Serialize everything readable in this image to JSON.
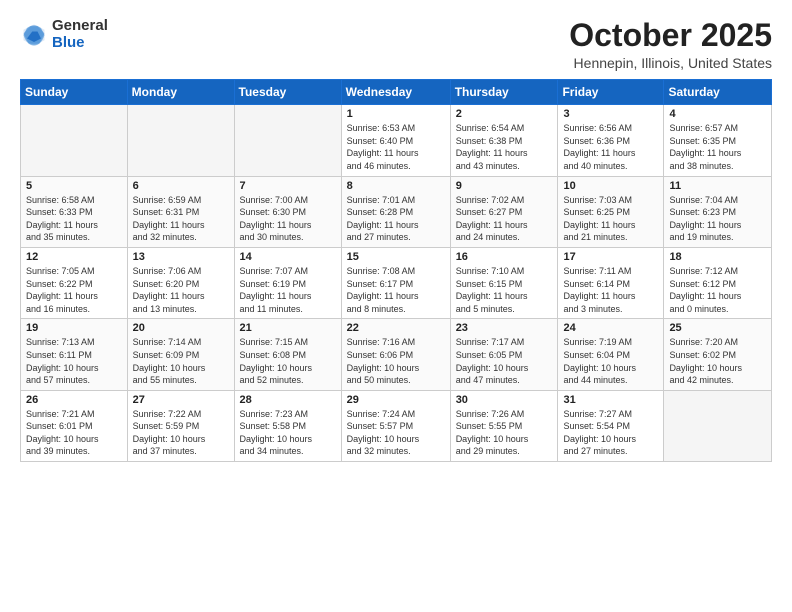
{
  "logo": {
    "general": "General",
    "blue": "Blue"
  },
  "title": "October 2025",
  "location": "Hennepin, Illinois, United States",
  "days_of_week": [
    "Sunday",
    "Monday",
    "Tuesday",
    "Wednesday",
    "Thursday",
    "Friday",
    "Saturday"
  ],
  "weeks": [
    [
      {
        "day": "",
        "info": ""
      },
      {
        "day": "",
        "info": ""
      },
      {
        "day": "",
        "info": ""
      },
      {
        "day": "1",
        "info": "Sunrise: 6:53 AM\nSunset: 6:40 PM\nDaylight: 11 hours\nand 46 minutes."
      },
      {
        "day": "2",
        "info": "Sunrise: 6:54 AM\nSunset: 6:38 PM\nDaylight: 11 hours\nand 43 minutes."
      },
      {
        "day": "3",
        "info": "Sunrise: 6:56 AM\nSunset: 6:36 PM\nDaylight: 11 hours\nand 40 minutes."
      },
      {
        "day": "4",
        "info": "Sunrise: 6:57 AM\nSunset: 6:35 PM\nDaylight: 11 hours\nand 38 minutes."
      }
    ],
    [
      {
        "day": "5",
        "info": "Sunrise: 6:58 AM\nSunset: 6:33 PM\nDaylight: 11 hours\nand 35 minutes."
      },
      {
        "day": "6",
        "info": "Sunrise: 6:59 AM\nSunset: 6:31 PM\nDaylight: 11 hours\nand 32 minutes."
      },
      {
        "day": "7",
        "info": "Sunrise: 7:00 AM\nSunset: 6:30 PM\nDaylight: 11 hours\nand 30 minutes."
      },
      {
        "day": "8",
        "info": "Sunrise: 7:01 AM\nSunset: 6:28 PM\nDaylight: 11 hours\nand 27 minutes."
      },
      {
        "day": "9",
        "info": "Sunrise: 7:02 AM\nSunset: 6:27 PM\nDaylight: 11 hours\nand 24 minutes."
      },
      {
        "day": "10",
        "info": "Sunrise: 7:03 AM\nSunset: 6:25 PM\nDaylight: 11 hours\nand 21 minutes."
      },
      {
        "day": "11",
        "info": "Sunrise: 7:04 AM\nSunset: 6:23 PM\nDaylight: 11 hours\nand 19 minutes."
      }
    ],
    [
      {
        "day": "12",
        "info": "Sunrise: 7:05 AM\nSunset: 6:22 PM\nDaylight: 11 hours\nand 16 minutes."
      },
      {
        "day": "13",
        "info": "Sunrise: 7:06 AM\nSunset: 6:20 PM\nDaylight: 11 hours\nand 13 minutes."
      },
      {
        "day": "14",
        "info": "Sunrise: 7:07 AM\nSunset: 6:19 PM\nDaylight: 11 hours\nand 11 minutes."
      },
      {
        "day": "15",
        "info": "Sunrise: 7:08 AM\nSunset: 6:17 PM\nDaylight: 11 hours\nand 8 minutes."
      },
      {
        "day": "16",
        "info": "Sunrise: 7:10 AM\nSunset: 6:15 PM\nDaylight: 11 hours\nand 5 minutes."
      },
      {
        "day": "17",
        "info": "Sunrise: 7:11 AM\nSunset: 6:14 PM\nDaylight: 11 hours\nand 3 minutes."
      },
      {
        "day": "18",
        "info": "Sunrise: 7:12 AM\nSunset: 6:12 PM\nDaylight: 11 hours\nand 0 minutes."
      }
    ],
    [
      {
        "day": "19",
        "info": "Sunrise: 7:13 AM\nSunset: 6:11 PM\nDaylight: 10 hours\nand 57 minutes."
      },
      {
        "day": "20",
        "info": "Sunrise: 7:14 AM\nSunset: 6:09 PM\nDaylight: 10 hours\nand 55 minutes."
      },
      {
        "day": "21",
        "info": "Sunrise: 7:15 AM\nSunset: 6:08 PM\nDaylight: 10 hours\nand 52 minutes."
      },
      {
        "day": "22",
        "info": "Sunrise: 7:16 AM\nSunset: 6:06 PM\nDaylight: 10 hours\nand 50 minutes."
      },
      {
        "day": "23",
        "info": "Sunrise: 7:17 AM\nSunset: 6:05 PM\nDaylight: 10 hours\nand 47 minutes."
      },
      {
        "day": "24",
        "info": "Sunrise: 7:19 AM\nSunset: 6:04 PM\nDaylight: 10 hours\nand 44 minutes."
      },
      {
        "day": "25",
        "info": "Sunrise: 7:20 AM\nSunset: 6:02 PM\nDaylight: 10 hours\nand 42 minutes."
      }
    ],
    [
      {
        "day": "26",
        "info": "Sunrise: 7:21 AM\nSunset: 6:01 PM\nDaylight: 10 hours\nand 39 minutes."
      },
      {
        "day": "27",
        "info": "Sunrise: 7:22 AM\nSunset: 5:59 PM\nDaylight: 10 hours\nand 37 minutes."
      },
      {
        "day": "28",
        "info": "Sunrise: 7:23 AM\nSunset: 5:58 PM\nDaylight: 10 hours\nand 34 minutes."
      },
      {
        "day": "29",
        "info": "Sunrise: 7:24 AM\nSunset: 5:57 PM\nDaylight: 10 hours\nand 32 minutes."
      },
      {
        "day": "30",
        "info": "Sunrise: 7:26 AM\nSunset: 5:55 PM\nDaylight: 10 hours\nand 29 minutes."
      },
      {
        "day": "31",
        "info": "Sunrise: 7:27 AM\nSunset: 5:54 PM\nDaylight: 10 hours\nand 27 minutes."
      },
      {
        "day": "",
        "info": ""
      }
    ]
  ]
}
